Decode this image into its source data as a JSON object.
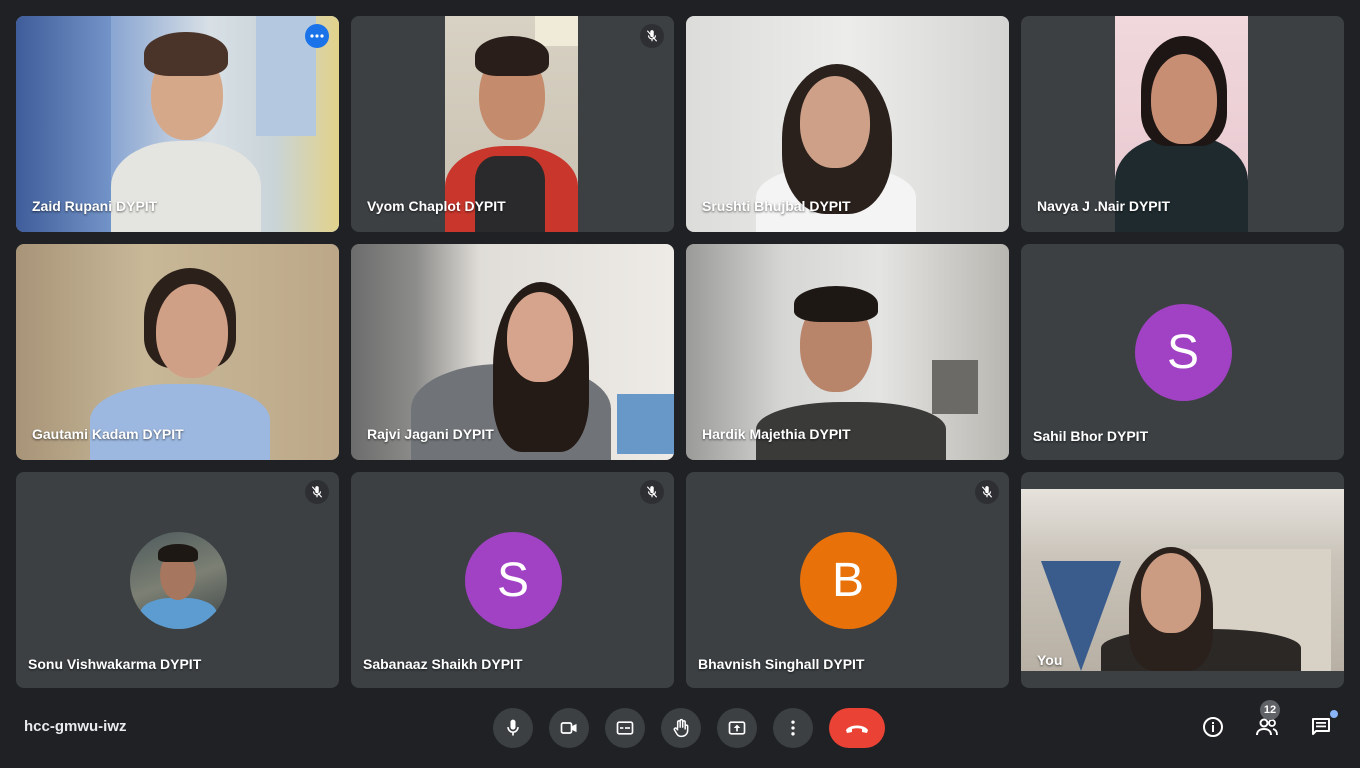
{
  "participants": [
    {
      "name": "Zaid Rupani DYPIT"
    },
    {
      "name": "Vyom Chaplot DYPIT"
    },
    {
      "name": "Srushti Bhujbal DYPIT"
    },
    {
      "name": "Navya J .Nair DYPIT"
    },
    {
      "name": "Gautami Kadam DYPIT"
    },
    {
      "name": "Rajvi Jagani DYPIT"
    },
    {
      "name": "Hardik Majethia DYPIT"
    },
    {
      "name": "Sahil Bhor DYPIT",
      "avatar_letter": "S",
      "avatar_color": "#a142c4"
    },
    {
      "name": "Sonu Vishwakarma DYPIT"
    },
    {
      "name": "Sabanaaz Shaikh DYPIT",
      "avatar_letter": "S",
      "avatar_color": "#a142c4"
    },
    {
      "name": "Bhavnish Singhall DYPIT",
      "avatar_letter": "B",
      "avatar_color": "#e8710a"
    },
    {
      "name": "You"
    }
  ],
  "meeting": {
    "code": "hcc-gmwu-iwz"
  },
  "participant_count": "12",
  "colors": {
    "background": "#202124",
    "tile": "#3c4043",
    "accent": "#8ab4f8",
    "hangup": "#ea4335"
  }
}
